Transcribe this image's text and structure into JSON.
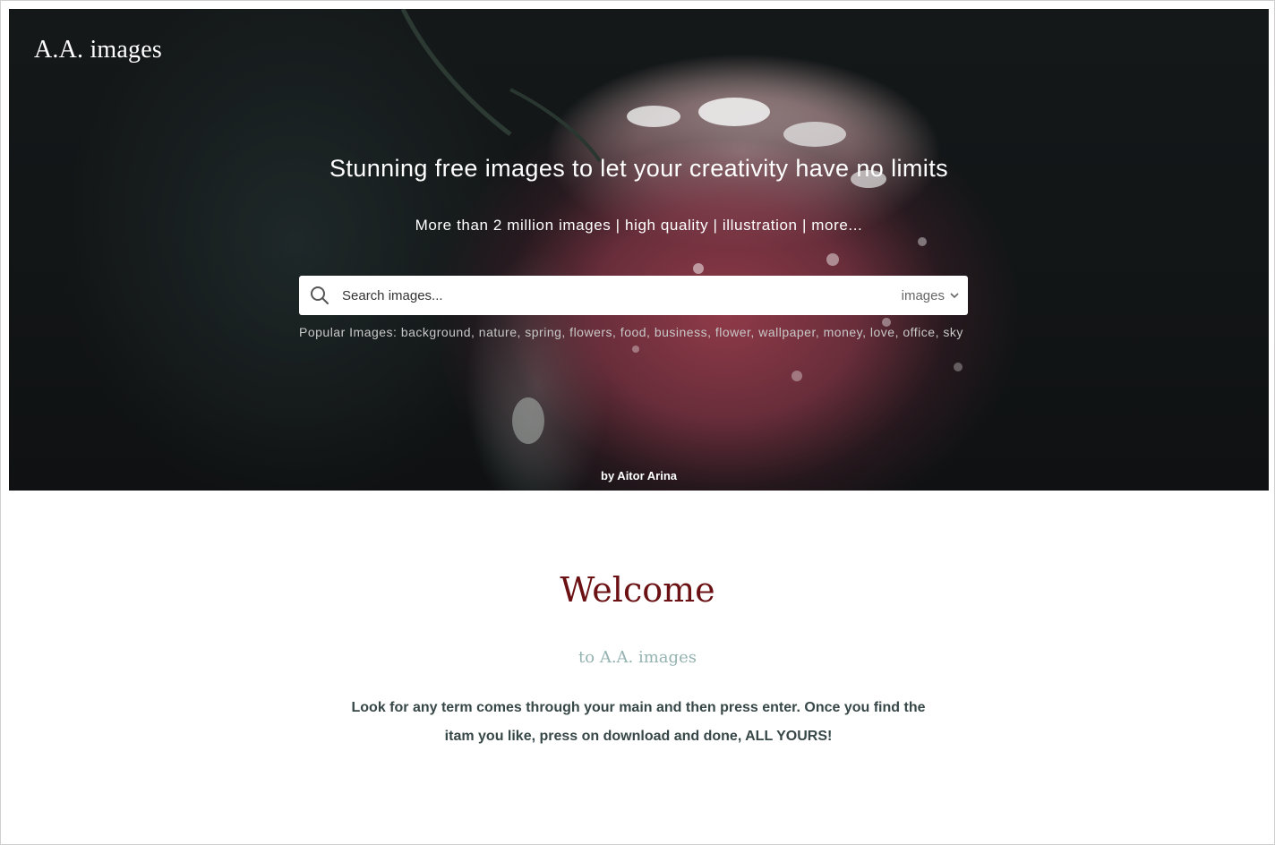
{
  "header": {
    "logo": "A.A. images"
  },
  "hero": {
    "title": "Stunning free images to let your creativity have no limits",
    "subtitle": "More than 2 million images | high quality | illustration | more...",
    "credit": "by Aitor Arina"
  },
  "search": {
    "placeholder": "Search images...",
    "type_selected": "images",
    "icon": "search-icon"
  },
  "popular": {
    "label": "Popular Images:",
    "terms": "background, nature, spring, flowers, food, business, flower, wallpaper, money, love, office, sky"
  },
  "welcome": {
    "title": "Welcome",
    "subtitle": "to A.A. images",
    "body": "Look for any term comes through your main and then press enter. Once you find the itam you like, press on download and done, ALL YOURS!"
  },
  "colors": {
    "welcome_title": "#6b1114",
    "welcome_subtitle": "#95b3b1",
    "body_text": "#374747"
  }
}
